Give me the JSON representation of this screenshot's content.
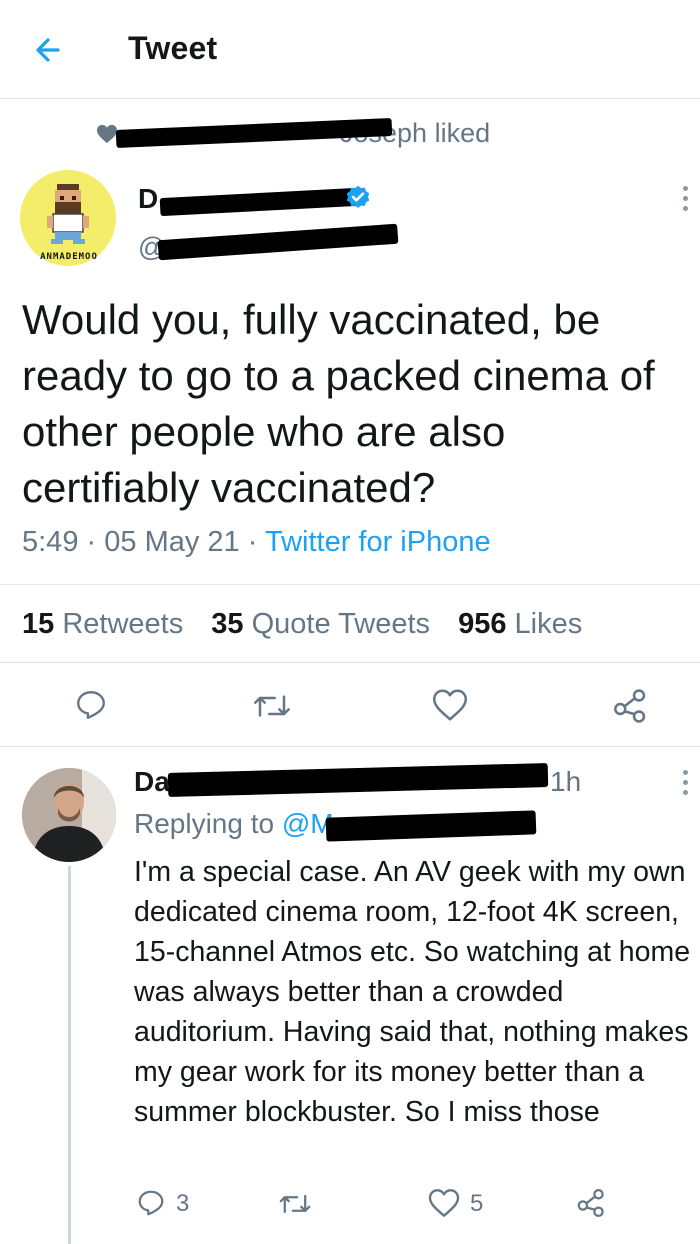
{
  "header": {
    "title": "Tweet"
  },
  "social_context": {
    "text": "Joseph liked"
  },
  "tweet": {
    "author_name_visible": "D",
    "avatar_caption": "ANMADEMOO",
    "text": "Would you, fully vaccinated, be ready to go to a packed cinema of other people who are also certifiably vaccinated?",
    "time": "5:49",
    "date": "05 May 21",
    "sep": "·",
    "source": "Twitter for iPhone",
    "stats": {
      "retweets_count": "15",
      "retweets_label": "Retweets",
      "quotes_count": "35",
      "quotes_label": "Quote Tweets",
      "likes_count": "956",
      "likes_label": "Likes"
    }
  },
  "reply": {
    "author_name_visible": "Da",
    "time": "1h",
    "replying_to_label": "Replying to",
    "replying_to_handle": "@M",
    "text": "I'm a special case. An AV geek with my own dedicated cinema room, 12-foot 4K screen, 15-channel Atmos etc. So watching at home was always better than a crowded auditorium. Having said that, nothing makes my gear work for its money better than a summer blockbuster. So I miss those",
    "reply_count": "3",
    "like_count": "5"
  },
  "icons": {
    "back": "arrow-left-icon",
    "reply": "comment-icon",
    "retweet": "retweet-icon",
    "like": "heart-icon",
    "share": "share-icon",
    "more": "more-vertical-icon",
    "verified": "verified-badge-icon"
  },
  "colors": {
    "accent": "#1da1f2",
    "secondary_text": "#657786",
    "border": "#e1e8ed"
  }
}
